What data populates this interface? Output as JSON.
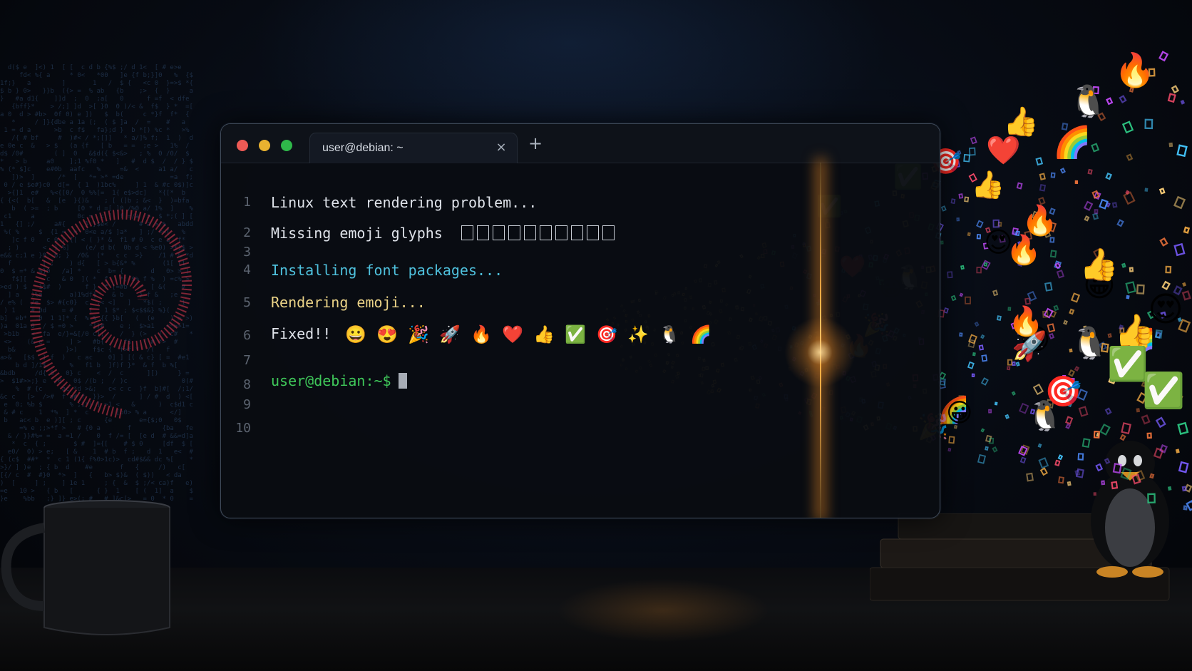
{
  "window": {
    "tab_title": "user@debian: ~",
    "close_glyph": "×",
    "new_tab_glyph": "+"
  },
  "terminal": {
    "line_numbers": [
      "1",
      "2",
      "3",
      "4",
      "5",
      "6",
      "7",
      "8",
      "9",
      "10"
    ],
    "lines": {
      "l1": "Linux text rendering problem...",
      "l2": "Missing emoji glyphs",
      "l4": "Installing font packages...",
      "l5": "Rendering emoji...",
      "l6": "Fixed!!",
      "l8": "user@debian:~$"
    },
    "missing_glyph_count": 10,
    "fixed_emojis": [
      "😀",
      "😍",
      "🎉",
      "🚀",
      "🔥",
      "❤️",
      "👍",
      "✅",
      "🎯",
      "✨",
      "🐧",
      "🌈"
    ]
  },
  "colors": {
    "text": "#dfe3ea",
    "cyan": "#4fc1dd",
    "yellow": "#ecd488",
    "prompt_green": "#3fc85a",
    "beam": "#ffb347",
    "close_red": "#ed5a55",
    "minimize_yellow": "#e9b230",
    "maximize_green": "#2fb84a"
  },
  "icons": {
    "close_dot": "close-window-dot-icon",
    "minimize_dot": "minimize-window-dot-icon",
    "maximize_dot": "maximize-window-dot-icon",
    "tab_close": "close-icon",
    "new_tab": "plus-icon"
  }
}
